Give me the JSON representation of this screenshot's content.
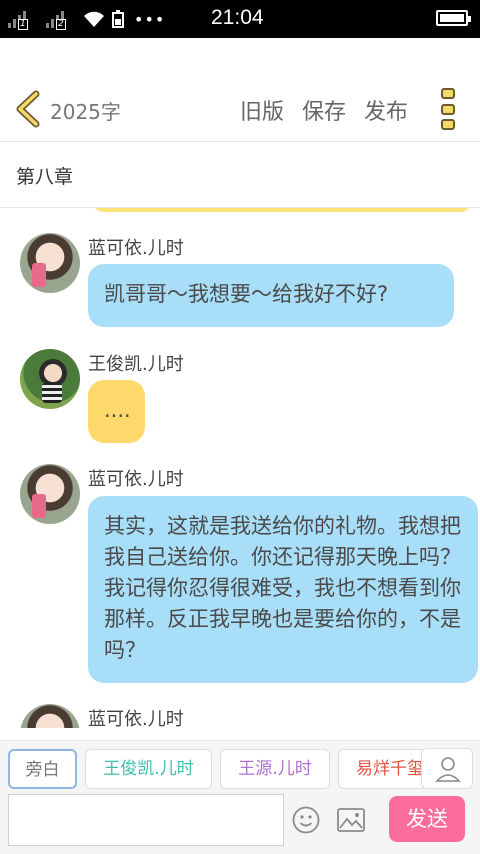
{
  "status_bar": {
    "time": "21:04",
    "sim1": "1",
    "sim2": "2",
    "more": "•••"
  },
  "header": {
    "word_count": "2025字",
    "actions": [
      "旧版",
      "保存",
      "发布"
    ]
  },
  "chapter": {
    "title": "第八章"
  },
  "messages": [
    {
      "name": "蓝可依.儿时",
      "text": "凯哥哥～我想要～给我好不好?",
      "color": "#a9def8"
    },
    {
      "name": "王俊凯.儿时",
      "text": "....",
      "color": "#fdd96b"
    },
    {
      "name": "蓝可依.儿时",
      "text": "其实，这就是我送给你的礼物。我想把我自己送给你。你还记得那天晚上吗？我记得你忍得很难受，我也不想看到你那样。反正我早晚也是要给你的，不是吗？",
      "color": "#a9def8"
    },
    {
      "name": "蓝可依.儿时",
      "text": "",
      "color": "#a9def8"
    }
  ],
  "roles": [
    {
      "label": "旁白",
      "color": "#777777"
    },
    {
      "label": "王俊凯.儿时",
      "color": "#3dbfae"
    },
    {
      "label": "王源.儿时",
      "color": "#b070d0"
    },
    {
      "label": "易烊千玺",
      "color": "#e0553f"
    }
  ],
  "input": {
    "placeholder": "",
    "send_label": "发送"
  },
  "colors": {
    "send": "#fb6d9b",
    "blue_bubble": "#a9def8",
    "yellow_bubble": "#fdd96b"
  }
}
